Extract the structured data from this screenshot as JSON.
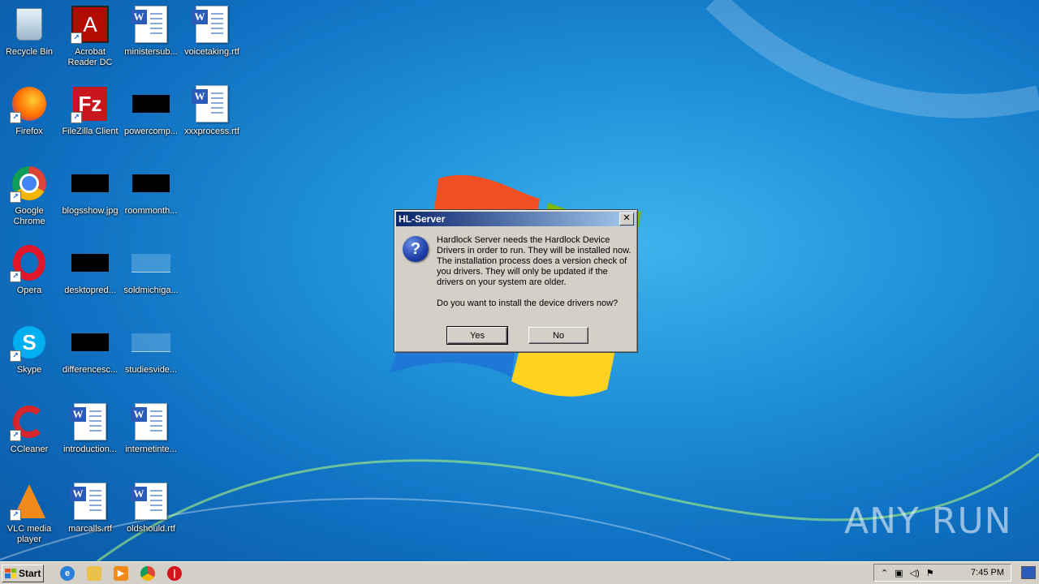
{
  "desktop": {
    "icons": [
      {
        "label": "Recycle Bin",
        "icon": "recycle-bin-icon"
      },
      {
        "label": "Acrobat Reader DC",
        "icon": "acrobat-reader-icon"
      },
      {
        "label": "ministersub...",
        "icon": "word-document-icon"
      },
      {
        "label": "voicetaking.rtf",
        "icon": "word-document-icon"
      },
      {
        "label": "Firefox",
        "icon": "firefox-icon"
      },
      {
        "label": "FileZilla Client",
        "icon": "filezilla-icon"
      },
      {
        "label": "powercomp...",
        "icon": "redacted-file-icon"
      },
      {
        "label": "xxxprocess.rtf",
        "icon": "word-document-icon"
      },
      {
        "label": "Google Chrome",
        "icon": "chrome-icon"
      },
      {
        "label": "blogsshow.jpg",
        "icon": "redacted-file-icon"
      },
      {
        "label": "roommonth...",
        "icon": "redacted-file-icon"
      },
      {
        "label": "Opera",
        "icon": "opera-icon"
      },
      {
        "label": "desktopred...",
        "icon": "redacted-file-icon"
      },
      {
        "label": "soldmichiga...",
        "icon": "blank-file-icon"
      },
      {
        "label": "Skype",
        "icon": "skype-icon"
      },
      {
        "label": "differencesc...",
        "icon": "redacted-file-icon"
      },
      {
        "label": "studiesvide...",
        "icon": "blank-file-icon"
      },
      {
        "label": "CCleaner",
        "icon": "ccleaner-icon"
      },
      {
        "label": "introduction...",
        "icon": "word-document-icon"
      },
      {
        "label": "internetinte...",
        "icon": "word-document-icon"
      },
      {
        "label": "VLC media player",
        "icon": "vlc-icon"
      },
      {
        "label": "marcalls.rtf",
        "icon": "word-document-icon"
      },
      {
        "label": "oldshould.rtf",
        "icon": "word-document-icon"
      }
    ]
  },
  "dialog": {
    "title": "HL-Server",
    "close_label": "✕",
    "icon": "question-icon",
    "message": "Hardlock Server needs the Hardlock Device Drivers in order to run. They will be installed now. The installation process does a version check of you drivers. They will only be updated if the drivers on your system are older.\n\nDo you want to install the device drivers now?",
    "yes_label": "Yes",
    "no_label": "No"
  },
  "watermark": {
    "text": "ANY RUN"
  },
  "taskbar": {
    "start_label": "Start",
    "pinned": [
      "internet-explorer-icon",
      "folder-icon",
      "media-player-icon",
      "chrome-icon",
      "stop-icon"
    ],
    "clock": "7:45 PM"
  },
  "colors": {
    "dialog_bg": "#d4d0c8",
    "title_gradient_start": "#0a246a",
    "desktop_blue": "#1e8fd8"
  }
}
